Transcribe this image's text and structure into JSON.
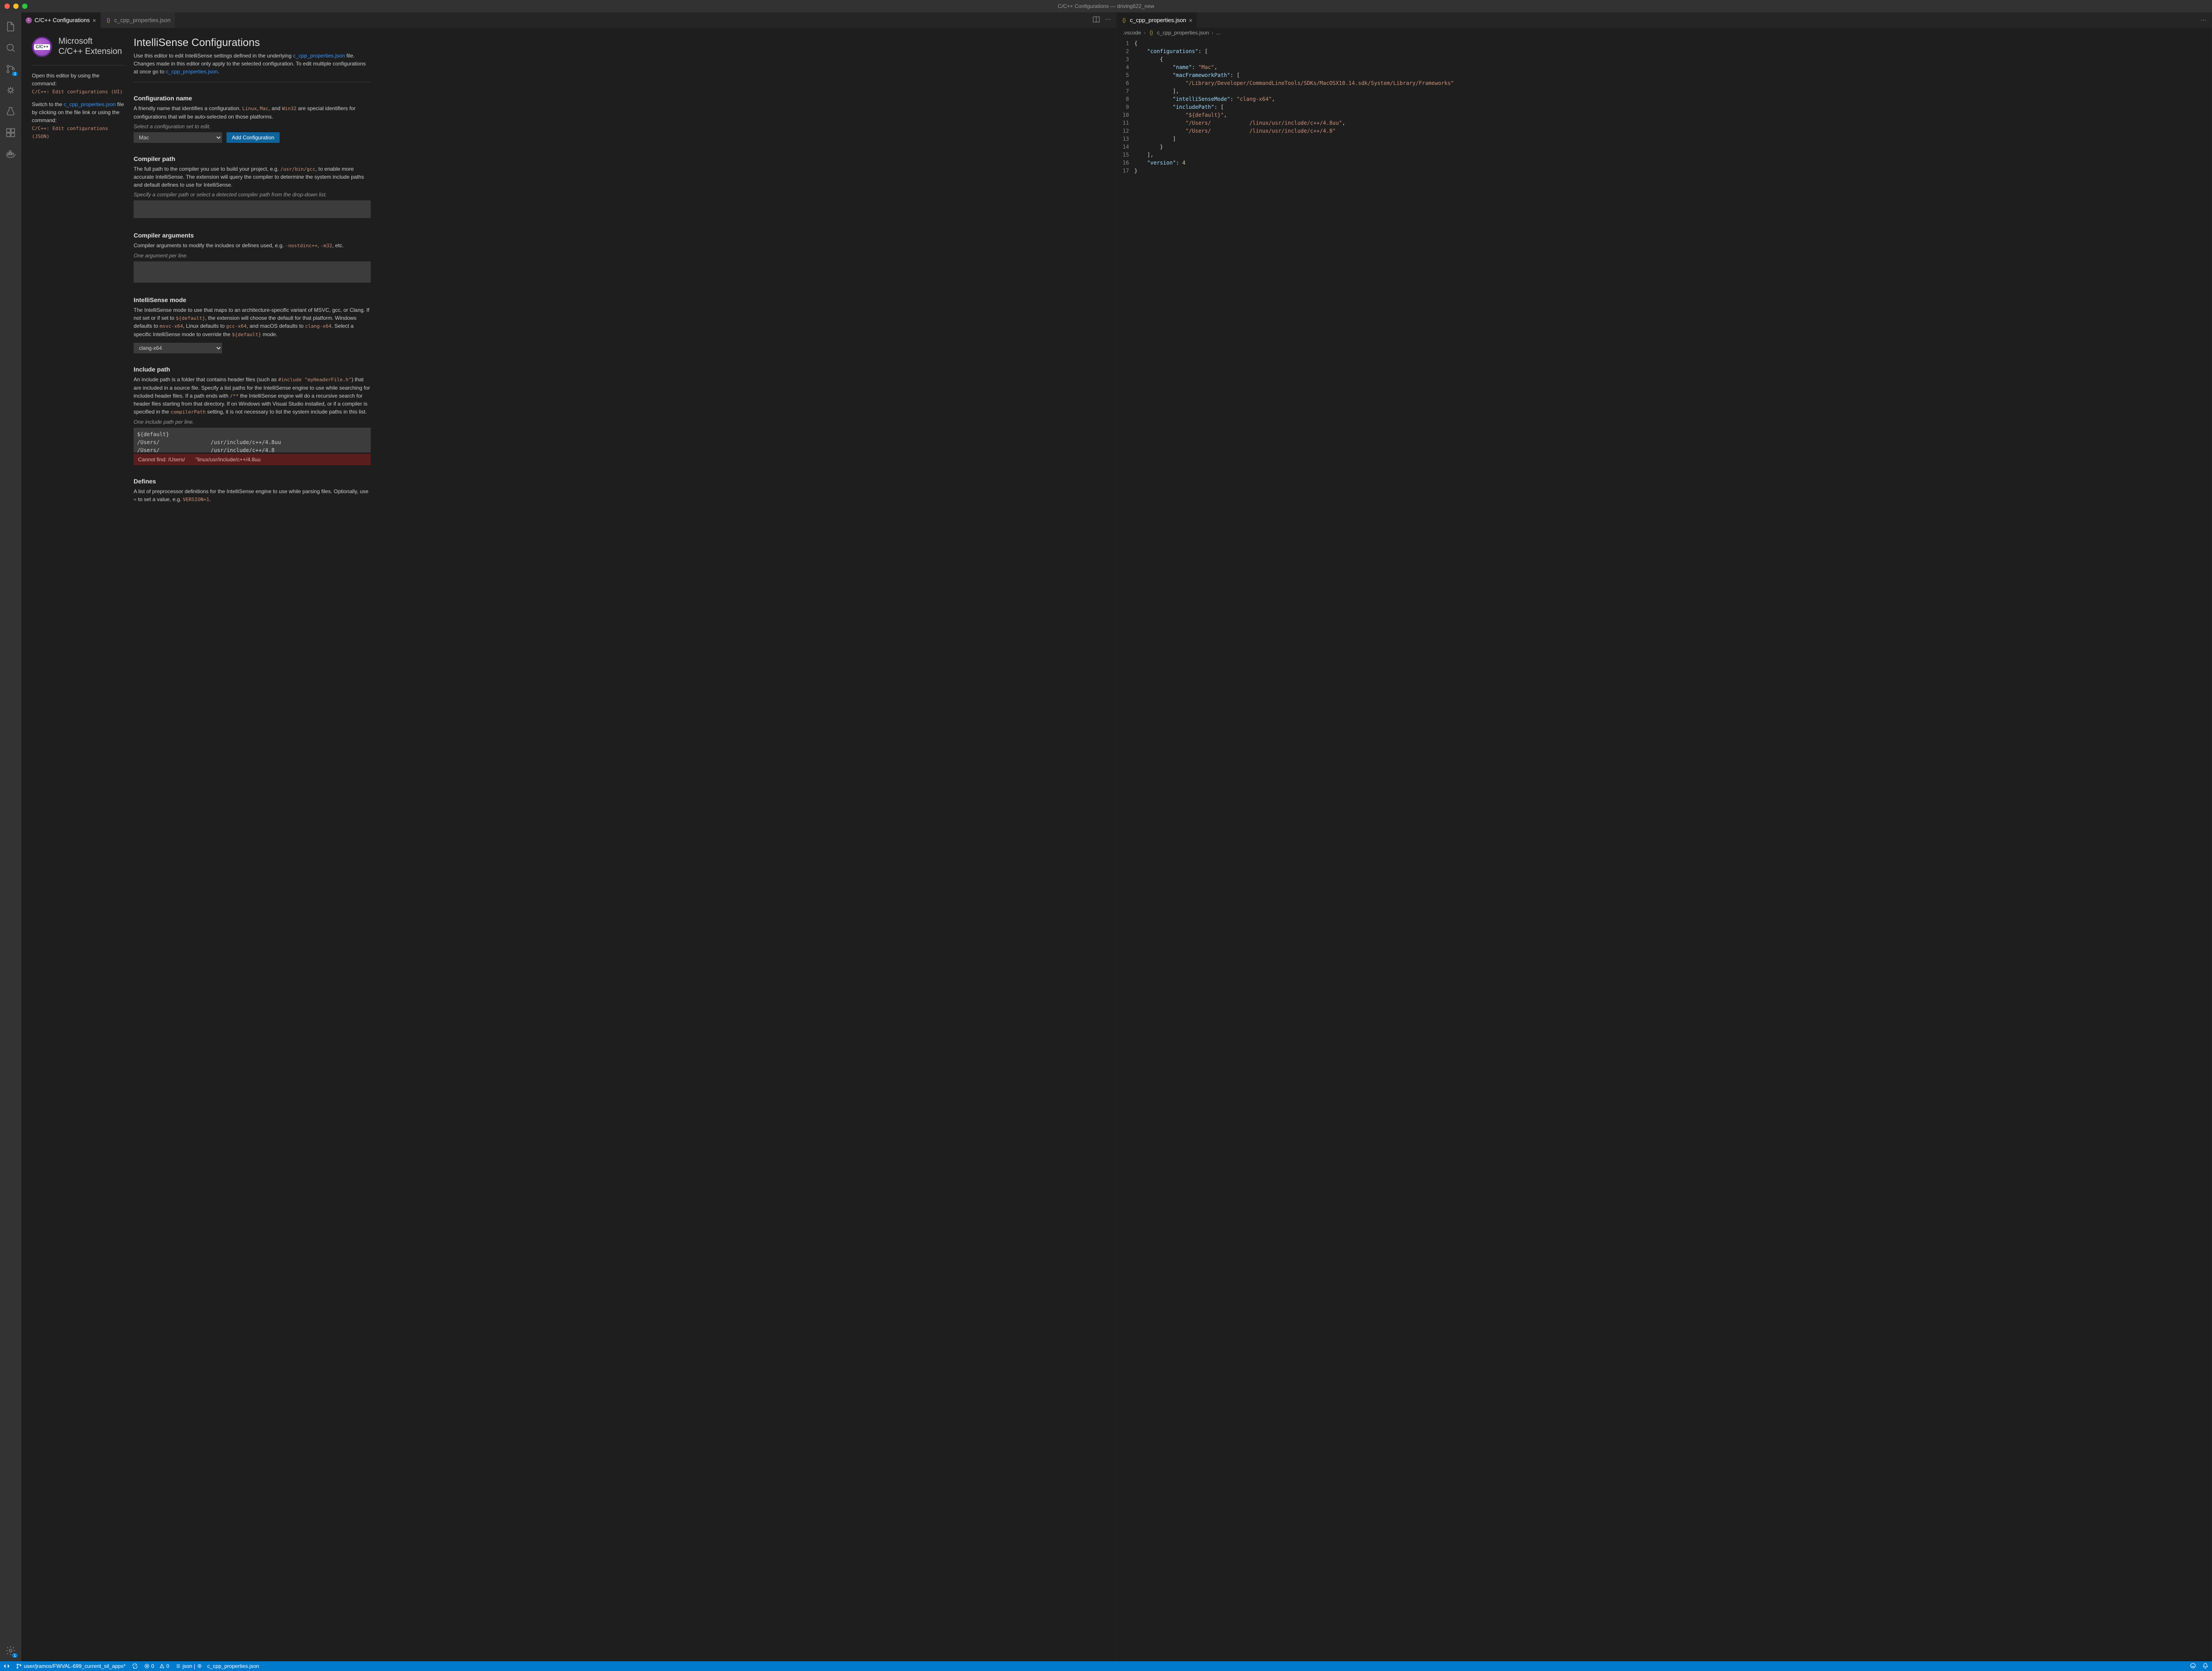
{
  "window": {
    "title": "C/C++ Configurations — driving622_new"
  },
  "tabs": {
    "left": [
      {
        "label": "C/C++ Configurations",
        "active": true
      },
      {
        "label": "c_cpp_properties.json",
        "active": false
      }
    ],
    "right": [
      {
        "label": "c_cpp_properties.json",
        "active": true
      }
    ]
  },
  "breadcrumb": {
    "folder": ".vscode",
    "file": "c_cpp_properties.json",
    "more": "..."
  },
  "extension": {
    "vendor": "Microsoft",
    "name": "C/C++ Extension",
    "logo_text": "C/C++"
  },
  "sidecol": {
    "open_prefix": "Open this editor by using the command:",
    "open_cmd": "C/C++: Edit configurations (UI)",
    "switch_prefix": "Switch to the ",
    "switch_link": "c_cpp_properties.json",
    "switch_suffix": " file by clicking on the file link or using the command:",
    "switch_cmd": "C/C++: Edit configurations (JSON)"
  },
  "page": {
    "title": "IntelliSense Configurations",
    "intro_a": "Use this editor to edit IntelliSense settings defined in the underlying ",
    "intro_link1": "c_cpp_properties.json",
    "intro_b": " file. Changes made in this editor only apply to the selected configuration. To edit multiple configurations at once go to ",
    "intro_link2": "c_cpp_properties.json",
    "intro_c": "."
  },
  "configName": {
    "heading": "Configuration name",
    "desc_a": "A friendly name that identifies a configuration. ",
    "code1": "Linux",
    "sep1": ", ",
    "code2": "Mac",
    "sep2": ", and ",
    "code3": "Win32",
    "desc_b": " are special identifiers for configurations that will be auto-selected on those platforms.",
    "hint": "Select a configuration set to edit.",
    "selected": "Mac",
    "button": "Add Configuration"
  },
  "compilerPath": {
    "heading": "Compiler path",
    "desc_a": "The full path to the compiler you use to build your project, e.g. ",
    "code1": "/usr/bin/gcc",
    "desc_b": ", to enable more accurate IntelliSense. The extension will query the compiler to determine the system include paths and default defines to use for IntelliSense.",
    "hint": "Specify a compiler path or select a detected compiler path from the drop-down list.",
    "value": ""
  },
  "compilerArgs": {
    "heading": "Compiler arguments",
    "desc_a": "Compiler arguments to modify the includes or defines used, e.g. ",
    "code1": "-nostdinc++",
    "sep": ", ",
    "code2": "-m32",
    "desc_b": ", etc.",
    "hint": "One argument per line.",
    "value": ""
  },
  "intellisenseMode": {
    "heading": "IntelliSense mode",
    "desc_a": "The IntelliSense mode to use that maps to an architecture-specific variant of MSVC, gcc, or Clang. If not set or if set to ",
    "code1": "${default}",
    "desc_b": ", the extension will choose the default for that platform. Windows defaults to ",
    "code2": "msvc-x64",
    "desc_c": ", Linux defaults to ",
    "code3": "gcc-x64",
    "desc_d": ", and macOS defaults to ",
    "code4": "clang-x64",
    "desc_e": ". Select a specific IntelliSense mode to override the ",
    "code5": "${default}",
    "desc_f": " mode.",
    "selected": "clang-x64"
  },
  "includePath": {
    "heading": "Include path",
    "desc_a": "An include path is a folder that contains header files (such as ",
    "code1": "#include \"myHeaderFile.h\"",
    "desc_b": ") that are included in a source file. Specify a list paths for the IntelliSense engine to use while searching for included header files. If a path ends with ",
    "code2": "/**",
    "desc_c": " the IntelliSense engine will do a recursive search for header files starting from that directory. If on Windows with Visual Studio installed, or if a compiler is specified in the ",
    "code3": "compilerPath",
    "desc_d": " setting, it is not necessary to list the system include paths in this list.",
    "hint": "One include path per line.",
    "value": "${default}\n/Users/                /usr/include/c++/4.8uu\n/Users/                /usr/include/c++/4.8",
    "error_label": "Cannot find: /Users/",
    "error_path": "\"linux/usr/include/c++/4.8uu"
  },
  "defines": {
    "heading": "Defines",
    "desc_a": "A list of preprocessor definitions for the IntelliSense engine to use while parsing files. Optionally, use ",
    "code1": "=",
    "desc_b": " to set a value, e.g. ",
    "code2": "VERSION=1",
    "desc_c": "."
  },
  "json": {
    "lines": [
      "{",
      "    \"configurations\": [",
      "        {",
      "            \"name\": \"Mac\",",
      "            \"macFrameworkPath\": [",
      "                \"/Library/Developer/CommandLineTools/SDKs/MacOSX10.14.sdk/System/Library/Frameworks\"",
      "            ],",
      "            \"intelliSenseMode\": \"clang-x64\",",
      "            \"includePath\": [",
      "                \"${default}\",",
      "                \"/Users/            /linux/usr/include/c++/4.8uu\",",
      "                \"/Users/            /linux/usr/include/c++/4.8\"",
      "            ]",
      "        }",
      "    ],",
      "    \"version\": 4",
      "}"
    ]
  },
  "statusbar": {
    "branch": "user/jramos/FWVAL-699_current_sil_apps*",
    "errors": "0",
    "warnings": "0",
    "indent": "json | ",
    "file": "c_cpp_properties.json"
  },
  "activity_badges": {
    "scm": "3",
    "settings": "1"
  }
}
